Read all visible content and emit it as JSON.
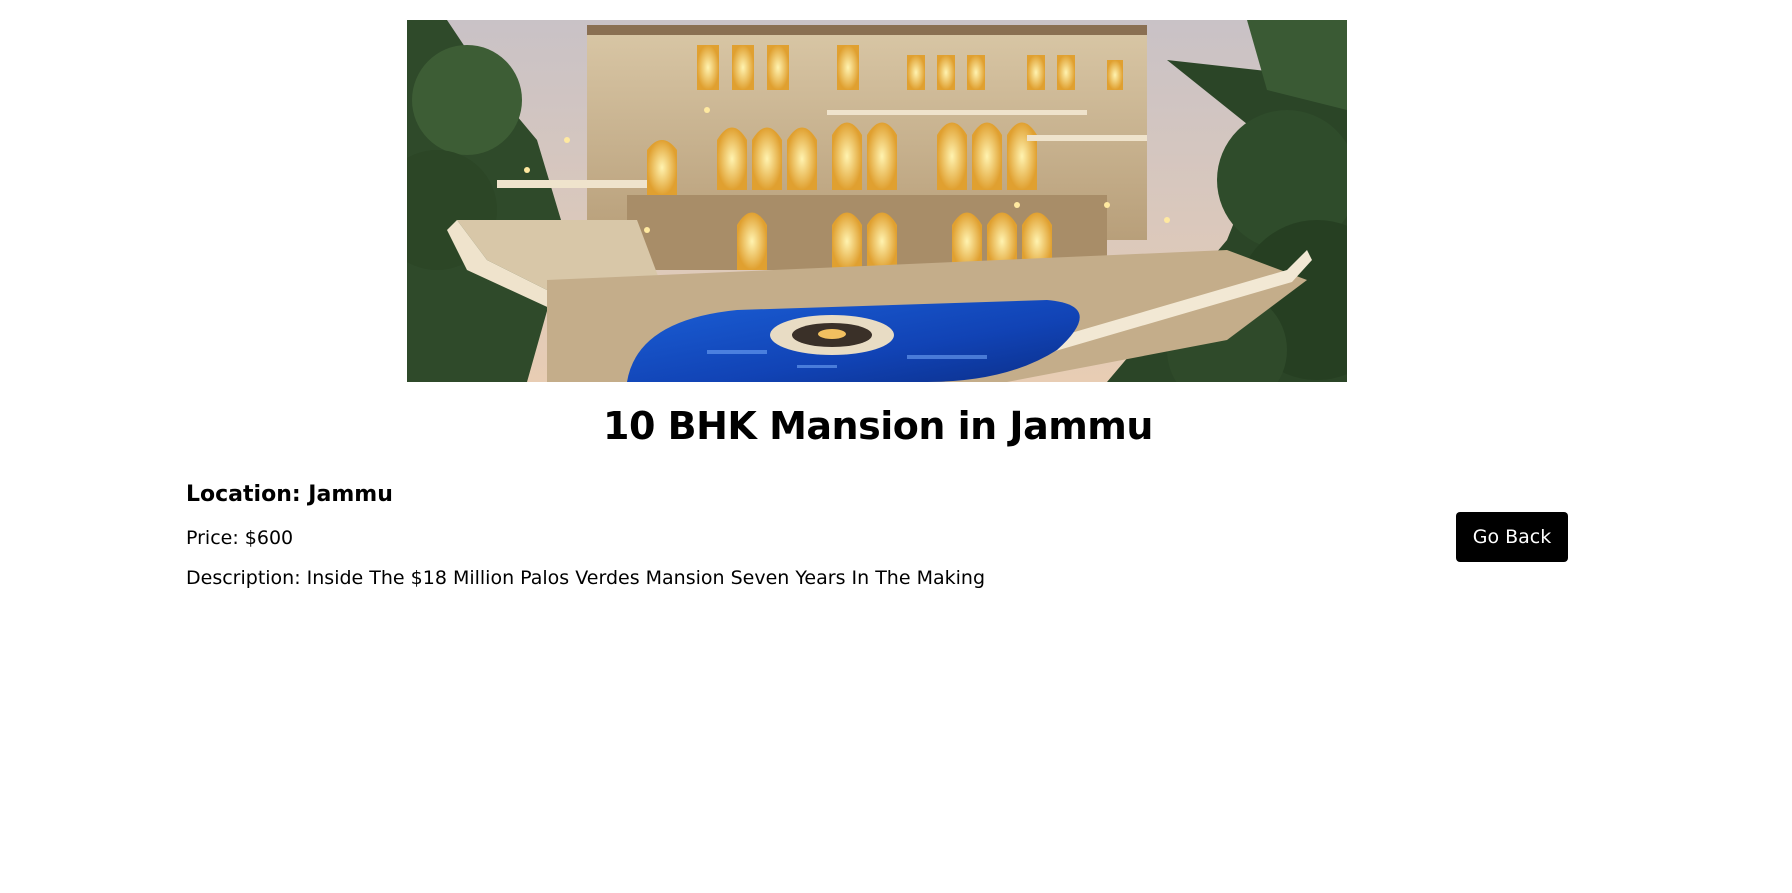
{
  "listing": {
    "image": {
      "alt": "Mansion exterior at dusk with pool"
    },
    "title": "10 BHK Mansion in Jammu",
    "location": "Location: Jammu",
    "price": "Price: $600",
    "description": "Description: Inside The $18 Million Palos Verdes Mansion Seven Years In The Making"
  },
  "actions": {
    "go_back_label": "Go Back"
  },
  "colors": {
    "button_bg": "#000000",
    "button_text": "#ffffff",
    "background": "#ffffff",
    "text": "#000000"
  }
}
